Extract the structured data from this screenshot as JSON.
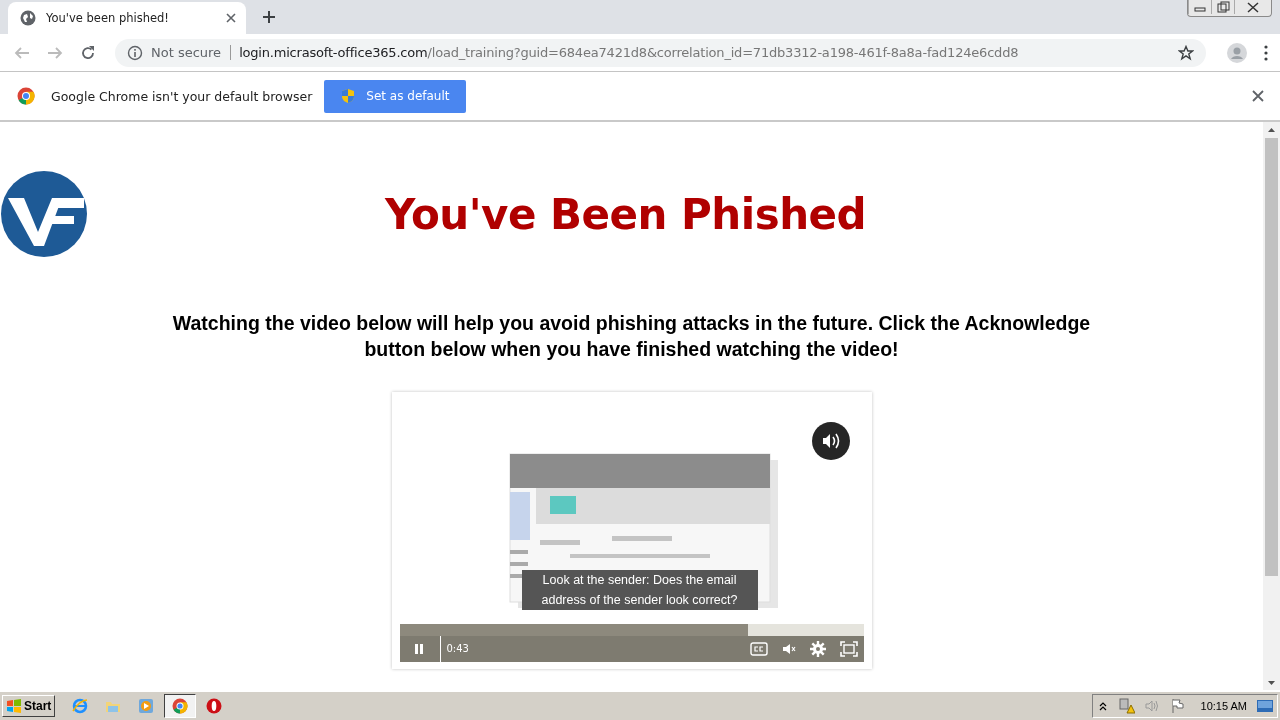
{
  "browser": {
    "tab": {
      "title": "You've been phished!"
    },
    "address": {
      "security": "Not secure",
      "host": "login.micrasoft-office365.com",
      "path": "/load_training?guid=684ea7421d8&correlation_id=71db3312-a198-461f-8a8a-fad124e6cdd8"
    }
  },
  "infobar": {
    "message": "Google Chrome isn't your default browser",
    "button": "Set as default"
  },
  "page": {
    "heading": "You've Been Phished",
    "instructions": "Watching the video below will help you avoid phishing attacks in the future. Click the Acknowledge button below when you have finished watching the video!",
    "video": {
      "caption": "Look at the sender: Does the email address of the sender look correct?",
      "time": "0:43",
      "playing": true,
      "progress": {
        "level": 0.75
      }
    }
  },
  "taskbar": {
    "start": "Start",
    "apps": [
      {
        "kind": "ie",
        "selected": false
      },
      {
        "kind": "explorer",
        "selected": false
      },
      {
        "kind": "media",
        "selected": false
      },
      {
        "kind": "chrome",
        "selected": true
      },
      {
        "kind": "opera",
        "selected": false
      }
    ],
    "clock": "10:15 AM"
  }
}
